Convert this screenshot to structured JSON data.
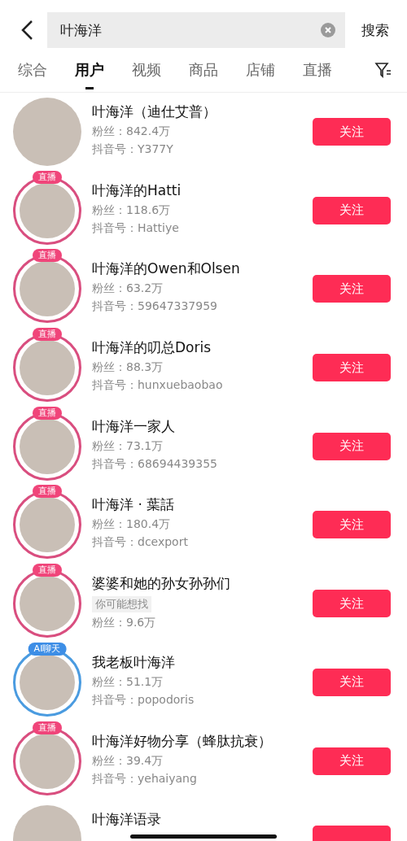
{
  "search": {
    "value": "叶海洋",
    "submit": "搜索"
  },
  "tabs": [
    {
      "label": "综合",
      "selected": false
    },
    {
      "label": "用户",
      "selected": true
    },
    {
      "label": "视频",
      "selected": false
    },
    {
      "label": "商品",
      "selected": false
    },
    {
      "label": "店铺",
      "selected": false
    },
    {
      "label": "直播",
      "selected": false
    }
  ],
  "users": [
    {
      "name": "叶海洋（迪仕艾普）",
      "fans": "粉丝：842.4万",
      "account": "抖音号：Y377Y",
      "button": "关注"
    },
    {
      "name": "叶海洋的Hatti",
      "badge": {
        "kind": "live",
        "label": "直播"
      },
      "fans": "粉丝：118.6万",
      "account": "抖音号：Hattiye",
      "button": "关注"
    },
    {
      "name": "叶海洋的Owen和Olsen",
      "badge": {
        "kind": "live",
        "label": "直播"
      },
      "fans": "粉丝：63.2万",
      "account": "抖音号：59647337959",
      "button": "关注"
    },
    {
      "name": "叶海洋的叨总Doris",
      "badge": {
        "kind": "live",
        "label": "直播"
      },
      "fans": "粉丝：88.3万",
      "account": "抖音号：hunxuebaobao",
      "button": "关注"
    },
    {
      "name": "叶海洋一家人",
      "badge": {
        "kind": "live",
        "label": "直播"
      },
      "fans": "粉丝：73.1万",
      "account": "抖音号：68694439355",
      "button": "关注"
    },
    {
      "name": "叶海洋 · 葉話",
      "badge": {
        "kind": "live",
        "label": "直播"
      },
      "fans": "粉丝：180.4万",
      "account": "抖音号：dcexport",
      "button": "关注"
    },
    {
      "name": "婆婆和她的孙女孙孙们",
      "badge": {
        "kind": "live",
        "label": "直播"
      },
      "tag": "你可能想找",
      "fans": "粉丝：9.6万",
      "button": "关注"
    },
    {
      "name": "我老板叶海洋",
      "badge": {
        "kind": "ai",
        "label": "AI聊天"
      },
      "fans": "粉丝：51.1万",
      "account": "抖音号：popodoris",
      "button": "关注"
    },
    {
      "name": "叶海洋好物分享（蜂肽抗衰）",
      "badge": {
        "kind": "live",
        "label": "直播"
      },
      "fans": "粉丝：39.4万",
      "account": "抖音号：yehaiyang",
      "button": "关注"
    },
    {
      "name": "叶海洋语录"
    }
  ]
}
